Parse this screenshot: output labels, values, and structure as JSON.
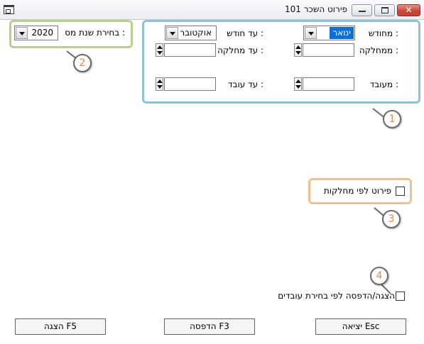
{
  "window": {
    "title": "פירוט השכר 101",
    "close_glyph": "✕"
  },
  "tax_year": {
    "label": "בחירת שנת מס :",
    "value": "2020"
  },
  "range": {
    "from_month_label": "מחודש :",
    "from_month_value": "ינואר",
    "to_month_label": "עד חודש :",
    "to_month_value": "אוקטובר",
    "from_department_label": "ממחלקה :",
    "to_department_label": "עד מחלקה :",
    "from_employee_label": "מעובד :",
    "to_employee_label": "עד עובד :",
    "from_department_value": "",
    "to_department_value": "",
    "from_employee_value": "",
    "to_employee_value": ""
  },
  "options": {
    "by_departments_label": "פירוט לפי מחלקות",
    "by_departments_checked": false,
    "by_employees_label": "הצגה/הדפסה לפי בחירת עובדים",
    "by_employees_checked": false
  },
  "buttons": {
    "exit": "יציאה Esc",
    "print": "הדפסה F3",
    "display": "הצגה F5"
  },
  "callouts": [
    "1",
    "2",
    "3",
    "4"
  ],
  "colors": {
    "callout_blue": "#8ec3d6",
    "callout_green": "#b7cf8f",
    "callout_orange": "#f2bf92",
    "callout_number": "#e08a4a",
    "selection": "#0a6fd6",
    "close_button": "#c9483d"
  }
}
